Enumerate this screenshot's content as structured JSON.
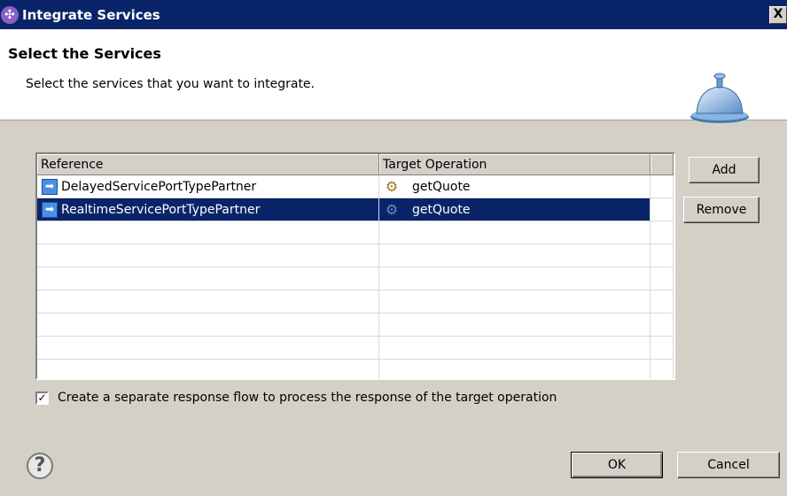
{
  "window": {
    "title": "Integrate Services",
    "close_label": "X"
  },
  "header": {
    "title": "Select the Services",
    "description": "Select the services that you want to integrate."
  },
  "table": {
    "columns": [
      "Reference",
      "Target Operation",
      ""
    ],
    "rows": [
      {
        "reference": "DelayedServicePortTypePartner",
        "operation": "getQuote",
        "selected": false
      },
      {
        "reference": "RealtimeServicePortTypePartner",
        "operation": "getQuote",
        "selected": true
      }
    ],
    "empty_rows": 7
  },
  "buttons": {
    "add": "Add",
    "remove": "Remove",
    "ok": "OK",
    "cancel": "Cancel"
  },
  "options": {
    "separate_response_flow": {
      "checked": true,
      "check_mark": "✓",
      "label": "Create a separate response flow to process the response of the target operation"
    }
  },
  "help": {
    "glyph": "?"
  },
  "colors": {
    "title_bar": "#0a246a",
    "selection": "#0a246a",
    "dialog_bg": "#d4d0c8"
  }
}
